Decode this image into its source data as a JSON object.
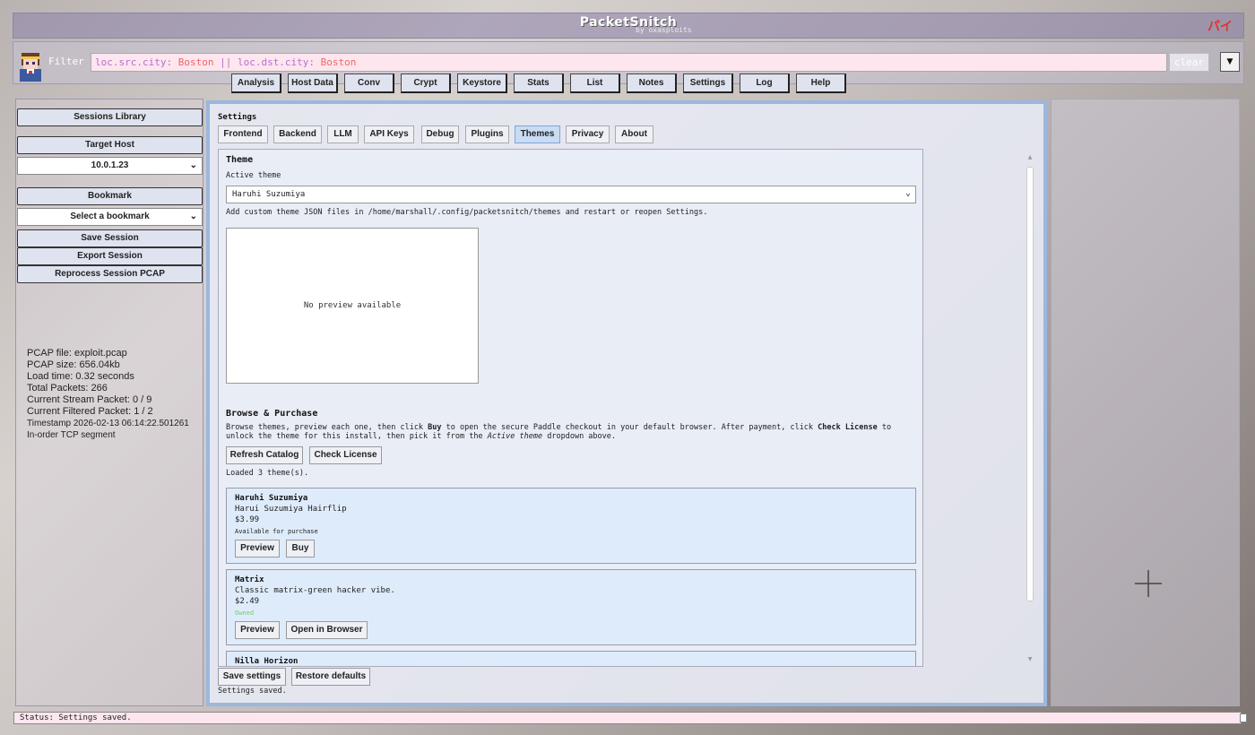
{
  "app": {
    "title": "PacketSnitch",
    "subtitle": "by oxasploits",
    "corner_logo": "パイ"
  },
  "filter": {
    "label": "Filter",
    "query_k1": "loc.src.city:",
    "query_v1": " Boston",
    "query_op": " || ",
    "query_k2": "loc.dst.city:",
    "query_v2": " Boston",
    "clear_label": "clear"
  },
  "toptabs": [
    "Analysis",
    "Host Data",
    "Conv",
    "Crypt",
    "Keystore",
    "Stats",
    "List",
    "Notes",
    "Settings",
    "Log",
    "Help"
  ],
  "sidebar": {
    "sessions_library": "Sessions Library",
    "target_host": "Target Host",
    "target_host_value": "10.0.1.23",
    "bookmark": "Bookmark",
    "bookmark_placeholder": "Select a bookmark",
    "save_session": "Save Session",
    "export_session": "Export Session",
    "reprocess": "Reprocess Session PCAP",
    "info": {
      "pcap_file": "PCAP file: exploit.pcap",
      "pcap_size": "PCAP size: 656.04kb",
      "load_time": "Load time: 0.32 seconds",
      "total_packets": "Total Packets: 266",
      "stream_packet": "Current Stream Packet: 0 / 9",
      "filtered_packet": "Current Filtered Packet: 1 / 2",
      "timestamp": "Timestamp 2026-02-13 06:14:22.501261",
      "segment": "In-order TCP segment"
    }
  },
  "settings": {
    "title": "Settings",
    "tabs": [
      "Frontend",
      "Backend",
      "LLM",
      "API Keys",
      "Debug",
      "Plugins",
      "Themes",
      "Privacy",
      "About"
    ],
    "active_tab": "Themes",
    "theme_heading": "Theme",
    "active_theme_label": "Active theme",
    "active_theme_value": "Haruhi Suzumiya",
    "custom_hint": "Add custom theme JSON files in /home/marshall/.config/packetsnitch/themes and restart or reopen Settings.",
    "preview_text": "No preview available",
    "browse_heading": "Browse & Purchase",
    "browse_desc_1": "Browse themes, preview each one, then click ",
    "browse_desc_buy": "Buy",
    "browse_desc_2": " to open the secure Paddle checkout in your default browser. After payment, click ",
    "browse_desc_check": "Check License",
    "browse_desc_3": " to unlock the theme for this install, then pick it from the ",
    "browse_desc_active": "Active theme",
    "browse_desc_4": " dropdown above.",
    "refresh_catalog": "Refresh Catalog",
    "check_license": "Check License",
    "loaded_msg": "Loaded 3 theme(s).",
    "themes": [
      {
        "name": "Haruhi Suzumiya",
        "desc": "Harui Suzumiya Hairflip",
        "price": "$3.99",
        "status": "Available for purchase",
        "btn1": "Preview",
        "btn2": "Buy"
      },
      {
        "name": "Matrix",
        "desc": "Classic matrix-green hacker vibe.",
        "price": "$2.49",
        "status": "Owned",
        "btn1": "Preview",
        "btn2": "Open in Browser"
      },
      {
        "name": "Nilla Horizon"
      }
    ],
    "save_settings": "Save settings",
    "restore_defaults": "Restore defaults",
    "saved_msg": "Settings saved."
  },
  "status": {
    "text": "Status: Settings saved."
  },
  "colors": {
    "accent": "#9bb7e0",
    "active_tab": "#c9dcf4",
    "filter_bg": "#fde6ee",
    "owned": "#6fcf6f"
  }
}
